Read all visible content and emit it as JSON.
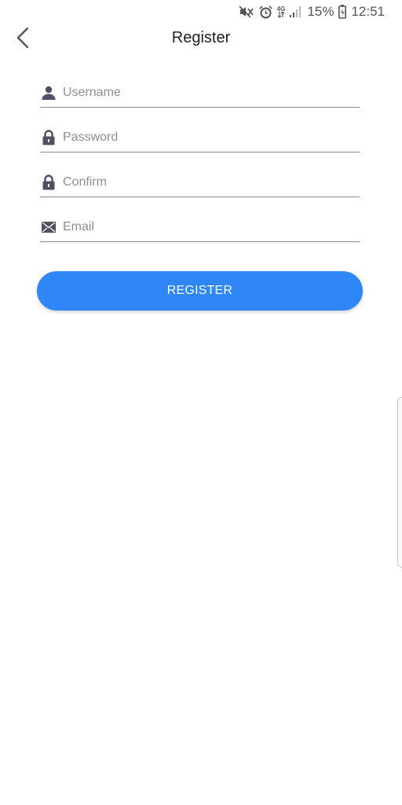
{
  "status_bar": {
    "battery_percent": "15%",
    "time": "12:51",
    "network_label": "4G",
    "icons": [
      "mute-icon",
      "alarm-icon",
      "network-4g-icon",
      "signal-icon",
      "battery-icon"
    ]
  },
  "app_bar": {
    "title": "Register",
    "back_icon": "chevron-left-icon"
  },
  "form": {
    "username": {
      "placeholder": "Username",
      "value": "",
      "icon": "person-icon"
    },
    "password": {
      "placeholder": "Password",
      "value": "",
      "icon": "lock-icon"
    },
    "confirm": {
      "placeholder": "Confirm",
      "value": "",
      "icon": "lock-icon"
    },
    "email": {
      "placeholder": "Email",
      "value": "",
      "icon": "envelope-icon"
    }
  },
  "actions": {
    "register_label": "REGISTER"
  },
  "colors": {
    "primary": "#2f86f6",
    "icon": "#4f5064",
    "divider": "#8a8a8a",
    "placeholder": "#8e8e95"
  }
}
